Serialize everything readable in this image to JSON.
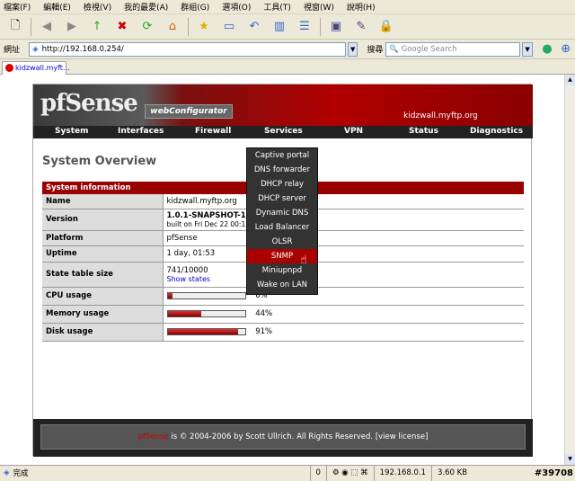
{
  "browser": {
    "menu": [
      "檔案(F)",
      "編輯(E)",
      "檢視(V)",
      "我的最愛(A)",
      "群組(G)",
      "選項(O)",
      "工具(T)",
      "視窗(W)",
      "說明(H)"
    ],
    "address_label": "網址",
    "address_value": "http://192.168.0.254/",
    "search_label": "搜尋",
    "search_placeholder": "Google Search",
    "tab_title": "kidzwall.myft..."
  },
  "page": {
    "brand_main": "pfSense",
    "brand_sub": "webConfigurator",
    "hostname": "kidzwall.myftp.org",
    "nav": [
      "System",
      "Interfaces",
      "Firewall",
      "Services",
      "VPN",
      "Status",
      "Diagnostics"
    ],
    "title": "System Overview",
    "table_header": "System information",
    "rows": {
      "name": {
        "label": "Name",
        "value": "kidzwall.myftp.org"
      },
      "version": {
        "label": "Version",
        "value": "1.0.1-SNAPSHOT-12-21",
        "sub": "built on Fri Dec 22 00:13:0"
      },
      "platform": {
        "label": "Platform",
        "value": "pfSense"
      },
      "uptime": {
        "label": "Uptime",
        "value": "1 day, 01:53"
      },
      "state": {
        "label": "State table size",
        "value": "741/10000",
        "link": "Show states"
      },
      "cpu": {
        "label": "CPU usage",
        "value": "6%",
        "level": 6
      },
      "memory": {
        "label": "Memory usage",
        "value": "44%",
        "level": 44
      },
      "disk": {
        "label": "Disk usage",
        "value": "91%",
        "level": 91
      }
    },
    "footer_brand": "pfSense",
    "footer_text": " is © 2004-2006 by Scott Ullrich. All Rights Reserved. [view license]"
  },
  "services_menu": [
    "Captive portal",
    "DNS forwarder",
    "DHCP relay",
    "DHCP server",
    "Dynamic DNS",
    "Load Balancer",
    "OLSR",
    "SNMP",
    "Miniupnpd",
    "Wake on LAN"
  ],
  "services_menu_active": "SNMP",
  "status": {
    "text": "完成",
    "count": "0",
    "ip": "192.168.0.1",
    "size": "3.60 KB",
    "watermark": "#39708"
  }
}
